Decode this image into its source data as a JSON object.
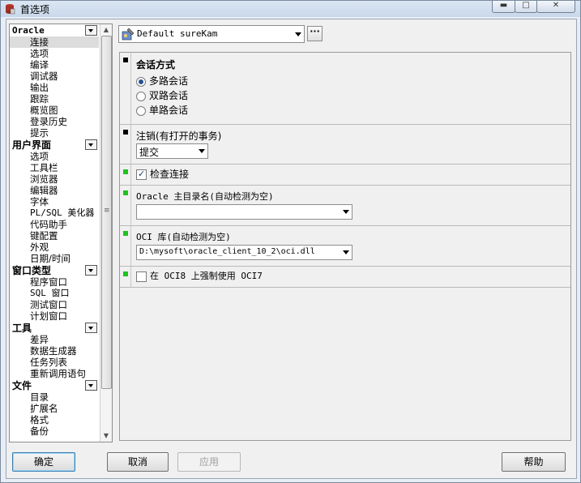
{
  "window": {
    "title": "首选项"
  },
  "nav": {
    "categories": [
      {
        "label": "Oracle",
        "items": [
          "连接",
          "选项",
          "编译",
          "调试器",
          "输出",
          "跟踪",
          "概览图",
          "登录历史",
          "提示"
        ],
        "selected": 0
      },
      {
        "label": "用户界面",
        "items": [
          "选项",
          "工具栏",
          "浏览器",
          "编辑器",
          "字体",
          "PL/SQL 美化器",
          "代码助手",
          "键配置",
          "外观",
          "日期/时间"
        ]
      },
      {
        "label": "窗口类型",
        "items": [
          "程序窗口",
          "SQL 窗口",
          "测试窗口",
          "计划窗口"
        ]
      },
      {
        "label": "工具",
        "items": [
          "差异",
          "数据生成器",
          "任务列表",
          "重新调用语句"
        ]
      },
      {
        "label": "文件",
        "items": [
          "目录",
          "扩展名",
          "格式",
          "备份"
        ]
      }
    ]
  },
  "profile": {
    "value": "Default sureKam",
    "icon": "profile-wrench-icon"
  },
  "sections": {
    "session_mode": {
      "title": "会话方式",
      "options": [
        "多路会话",
        "双路会话",
        "单路会话"
      ],
      "selected": 0
    },
    "logoff": {
      "title": "注销(有打开的事务)",
      "value": "提交"
    },
    "check_conn": {
      "label": "检查连接",
      "checked": true
    },
    "oracle_home": {
      "label": "Oracle 主目录名(自动检测为空)",
      "value": ""
    },
    "oci_lib": {
      "label": "OCI 库(自动检测为空)",
      "value": "D:\\mysoft\\oracle_client_10_2\\oci.dll"
    },
    "force_oci7": {
      "label": "在 OCI8 上强制使用 OCI7",
      "checked": false
    }
  },
  "buttons": {
    "ok": "确定",
    "cancel": "取消",
    "apply": "应用",
    "help": "帮助"
  },
  "colors": {
    "marker_black": "#000000",
    "marker_green": "#1fc21f",
    "accent": "#3c7fb1"
  }
}
